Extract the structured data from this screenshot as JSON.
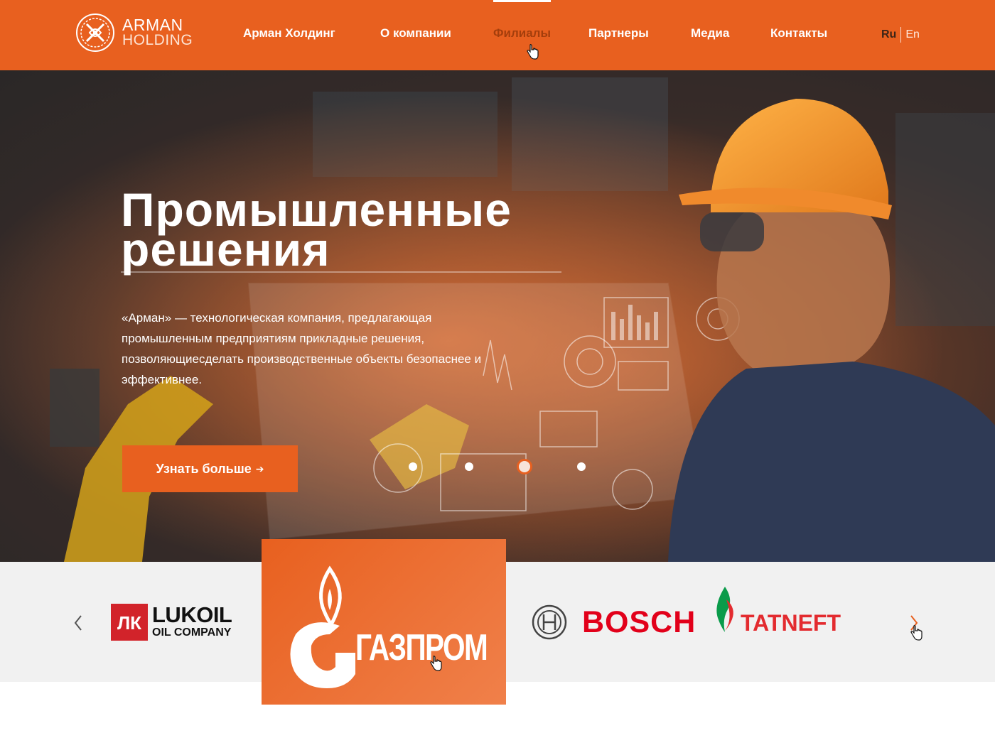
{
  "header": {
    "logo": {
      "line1": "ARMAN",
      "line2": "HOLDING"
    },
    "nav": [
      {
        "label": "Арман Холдинг",
        "active": false
      },
      {
        "label": "О компании",
        "active": false
      },
      {
        "label": "Филиалы",
        "active": true
      },
      {
        "label": "Партнеры",
        "active": false
      },
      {
        "label": "Медиа",
        "active": false
      },
      {
        "label": "Контакты",
        "active": false
      }
    ],
    "lang": {
      "ru": "Ru",
      "en": "En",
      "selected": "Ru"
    }
  },
  "hero": {
    "title_line1": "Промышленные",
    "title_line2": "решения",
    "description": "«Арман» — технологическая компания, предлагающая промышленным предприятиям прикладные решения, позволяющиесделать производственные объекты безопаснее и эффективнее.",
    "button_label": "Узнать больше",
    "slides_total": 4,
    "active_slide": 3
  },
  "partners": {
    "items": [
      {
        "name": "LUKOIL",
        "line1": "LUKOIL",
        "line2": "OIL COMPANY",
        "mark": "ЛК"
      },
      {
        "name": "ГАЗПРОМ",
        "text": "ГАЗПРОМ",
        "highlighted": true
      },
      {
        "name": "BOSCH",
        "text": "BOSCH"
      },
      {
        "name": "TATNEFT",
        "text": "TATNEFT"
      }
    ],
    "colors": {
      "accent": "#e8601f",
      "lukoil_red": "#d2232a",
      "bosch_red": "#e2001a",
      "tatneft_red": "#e32b2f",
      "tatneft_green": "#0a9b4a"
    }
  },
  "colors": {
    "accent": "#e8601f",
    "active_nav": "#a43e0c"
  }
}
